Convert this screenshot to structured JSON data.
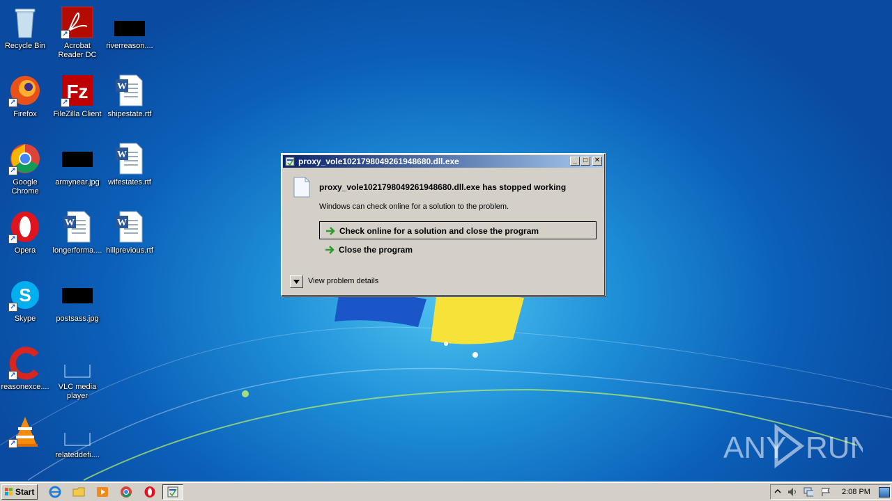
{
  "desktop": {
    "icons": [
      {
        "label": "Recycle Bin",
        "icon": "recycle-bin-icon"
      },
      {
        "label": "Acrobat Reader DC",
        "icon": "acrobat-reader-icon"
      },
      {
        "label": "riverreason....",
        "icon": "redacted-file-icon"
      },
      {
        "label": "Firefox",
        "icon": "firefox-icon"
      },
      {
        "label": "FileZilla Client",
        "icon": "filezilla-icon"
      },
      {
        "label": "shipestate.rtf",
        "icon": "word-document-icon"
      },
      {
        "label": "Google Chrome",
        "icon": "chrome-icon"
      },
      {
        "label": "armynear.jpg",
        "icon": "redacted-file-icon"
      },
      {
        "label": "wifestates.rtf",
        "icon": "word-document-icon"
      },
      {
        "label": "Opera",
        "icon": "opera-icon"
      },
      {
        "label": "longerforma....",
        "icon": "word-document-icon"
      },
      {
        "label": "hillprevious.rtf",
        "icon": "word-document-icon"
      },
      {
        "label": "Skype",
        "icon": "skype-icon"
      },
      {
        "label": "postsass.jpg",
        "icon": "redacted-file-icon"
      },
      {
        "label": "CCleaner",
        "icon": "ccleaner-icon"
      },
      {
        "label": "reasonexce....",
        "icon": "blank-file-icon"
      },
      {
        "label": "VLC media player",
        "icon": "vlc-icon"
      },
      {
        "label": "relateddefi....",
        "icon": "blank-file-icon"
      }
    ]
  },
  "dialog": {
    "title": "proxy_vole1021798049261948680.dll.exe",
    "message_title": "proxy_vole1021798049261948680.dll.exe has stopped working",
    "message_sub": "Windows can check online for a solution to the problem.",
    "option_check_online": "Check online for a solution and close the program",
    "option_close": "Close the program",
    "details_label": "View problem details",
    "minimize_glyph": "_",
    "maximize_glyph": "□",
    "close_glyph": "✕"
  },
  "taskbar": {
    "start_label": "Start",
    "clock": "2:08 PM",
    "quick_launch": [
      "internet-explorer-icon",
      "explorer-folder-icon",
      "media-player-icon",
      "chrome-icon",
      "opera-icon"
    ],
    "tray": [
      "show-hidden-icons-icon",
      "volume-icon",
      "network-icon",
      "action-center-flag-icon",
      "show-desktop-button"
    ]
  },
  "watermark": {
    "text_left": "ANY",
    "text_right": "RUN"
  },
  "colors": {
    "title_start": "#0a246a",
    "title_end": "#a6caf0",
    "dialog_bg": "#d4d0c8",
    "arrow_green": "#2e9b2e",
    "desktop_blue": "#1e8fd8"
  }
}
